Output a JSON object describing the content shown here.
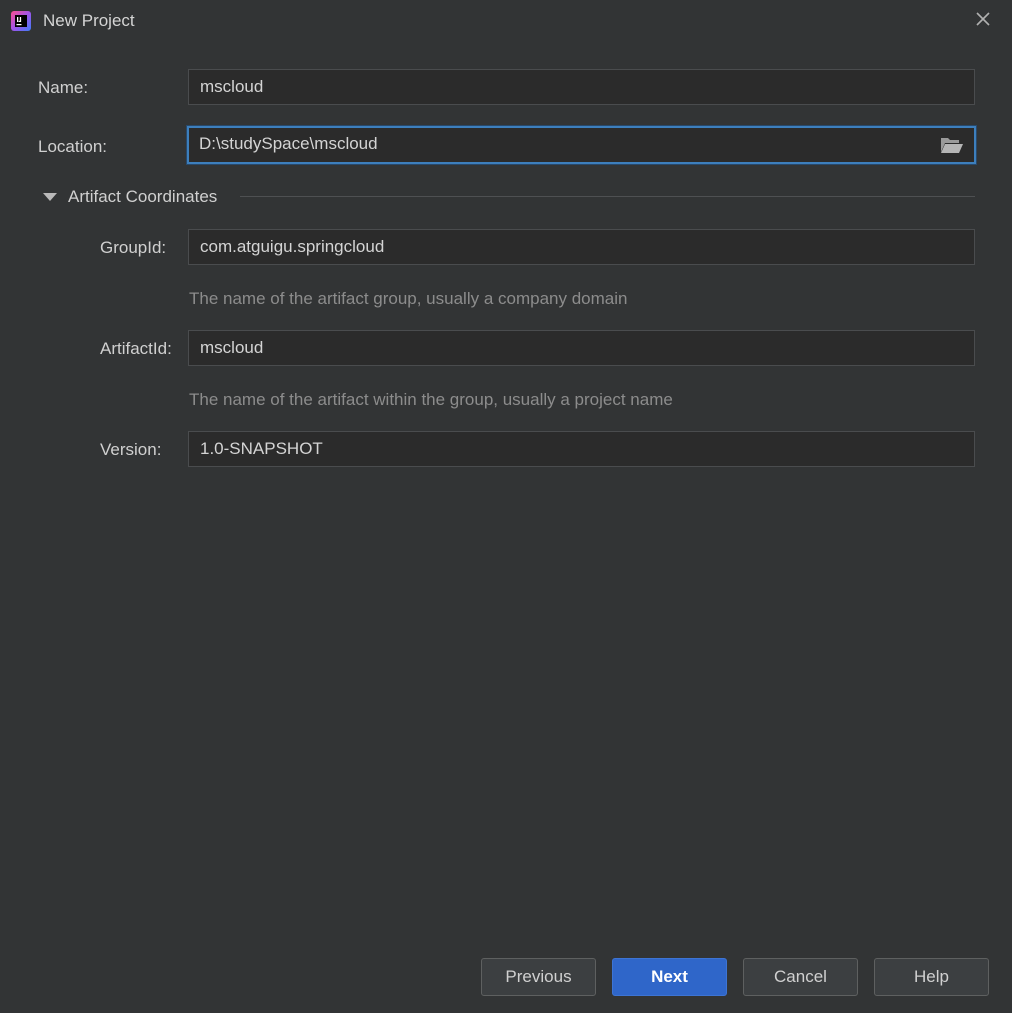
{
  "window": {
    "title": "New Project",
    "app_icon": "intellij-idea-icon",
    "close_icon": "close-icon"
  },
  "form": {
    "name_label": "Name:",
    "name_value": "mscloud",
    "location_label": "Location:",
    "location_value": "D:\\studySpace\\mscloud",
    "browse_icon": "folder-open-icon"
  },
  "artifact": {
    "section_title": "Artifact Coordinates",
    "expanded": true,
    "group_label": "GroupId:",
    "group_value": "com.atguigu.springcloud",
    "group_hint": "The name of the artifact group, usually a company domain",
    "artifact_label": "ArtifactId:",
    "artifact_value": "mscloud",
    "artifact_hint": "The name of the artifact within the group, usually a project name",
    "version_label": "Version:",
    "version_value": "1.0-SNAPSHOT"
  },
  "buttons": {
    "previous": "Previous",
    "next": "Next",
    "cancel": "Cancel",
    "help": "Help"
  },
  "colors": {
    "background": "#323435",
    "field_background": "#2b2b2b",
    "focus_border": "#3d7fbd",
    "primary_button": "#2f66c9"
  }
}
